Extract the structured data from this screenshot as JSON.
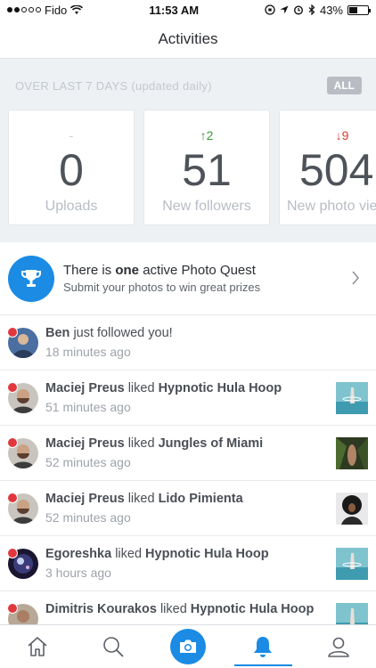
{
  "status_bar": {
    "carrier": "Fido",
    "time": "11:53 AM",
    "battery": "43%",
    "battery_level": 0.43
  },
  "header": {
    "title": "Activities"
  },
  "stats": {
    "caption": "OVER LAST 7 DAYS (updated daily)",
    "all_label": "ALL",
    "cards": [
      {
        "delta": "-",
        "number": "0",
        "label": "Uploads"
      },
      {
        "delta": "↑2",
        "number": "51",
        "label": "New followers"
      },
      {
        "delta": "↓9",
        "number": "504",
        "label": "New photo vie"
      }
    ]
  },
  "quest": {
    "title_prefix": "There is ",
    "title_bold": "one",
    "title_suffix": " active Photo Quest",
    "subtitle": "Submit your photos to win great prizes"
  },
  "activities": [
    {
      "user": "Ben",
      "action": "just followed you!",
      "photo": "",
      "time": "18 minutes ago"
    },
    {
      "user": "Maciej Preus",
      "action": "liked",
      "photo": "Hypnotic Hula Hoop",
      "time": "51 minutes ago"
    },
    {
      "user": "Maciej Preus",
      "action": "liked",
      "photo": "Jungles of Miami",
      "time": "52 minutes ago"
    },
    {
      "user": "Maciej Preus",
      "action": "liked",
      "photo": "Lido Pimienta",
      "time": "52 minutes ago"
    },
    {
      "user": "Egoreshka",
      "action": "liked",
      "photo": "Hypnotic Hula Hoop",
      "time": "3 hours ago"
    },
    {
      "user": "Dimitris Kourakos",
      "action": "liked",
      "photo": "Hypnotic Hula Hoop",
      "time": ""
    }
  ],
  "colors": {
    "accent": "#1b8be4",
    "up": "#3a9a33",
    "down": "#d33b32",
    "unread_dot": "#e0383e"
  }
}
